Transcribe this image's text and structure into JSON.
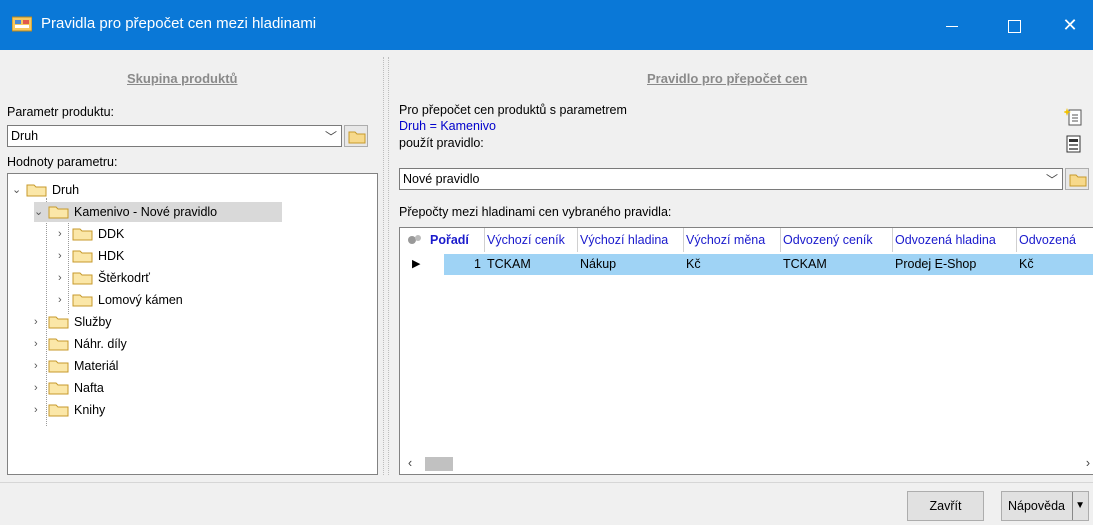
{
  "window": {
    "title": "Pravidla pro přepočet cen mezi hladinami",
    "minimize_label": "—",
    "close_label": "✕"
  },
  "left": {
    "group_title": "Skupina produktů",
    "param_label": "Parametr produktu:",
    "param_value": "Druh",
    "values_label": "Hodnoty parametru:",
    "tree": {
      "root": "Druh",
      "selected": "Kamenivo  - Nové pravidlo",
      "children_of_selected": [
        "DDK",
        "HDK",
        "Štěrkodrť",
        "Lomový kámen"
      ],
      "siblings": [
        "Služby",
        "Náhr. díly",
        "Materiál",
        "Nafta",
        "Knihy"
      ]
    }
  },
  "right": {
    "group_title": "Pravidlo pro přepočet cen",
    "intro_line1": "Pro přepočet cen produktů s parametrem",
    "intro_line2": "Druh = Kamenivo",
    "intro_line3": "použít pravidlo:",
    "rule_value": "Nové pravidlo",
    "grid_label": "Přepočty mezi hladinami cen vybraného pravidla:",
    "columns": [
      "Pořadí",
      "Výchozí ceník",
      "Výchozí hladina",
      "Výchozí měna",
      "Odvozený ceník",
      "Odvozená hladina",
      "Odvozená"
    ],
    "rows": [
      [
        "1",
        "TCKAM",
        "Nákup",
        "Kč",
        "TCKAM",
        "Prodej E-Shop",
        "Kč"
      ]
    ],
    "row_marker": "▶"
  },
  "footer": {
    "close_label": "Zavřít",
    "help_label": "Nápověda"
  },
  "colors": {
    "titlebar": "#0a78d7",
    "selected_row": "#9fd3f5",
    "column_header_text": "#1a1acc"
  }
}
